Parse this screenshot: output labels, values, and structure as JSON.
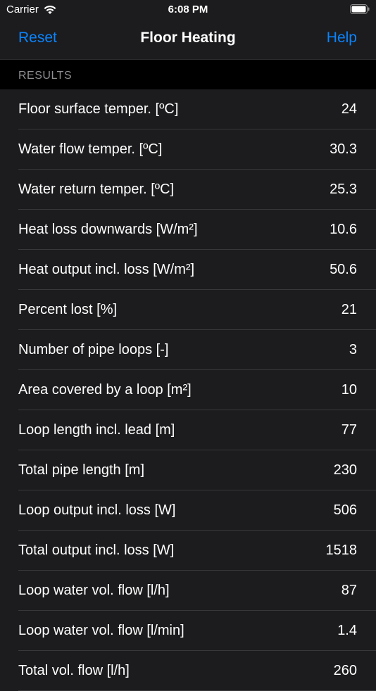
{
  "status_bar": {
    "carrier": "Carrier",
    "time": "6:08 PM",
    "icons": [
      "wifi-icon",
      "battery-icon"
    ]
  },
  "nav": {
    "left_label": "Reset",
    "title": "Floor Heating",
    "right_label": "Help"
  },
  "section": {
    "header": "RESULTS"
  },
  "results": [
    {
      "label": "Floor surface temper. [ºC]",
      "value": "24"
    },
    {
      "label": "Water flow temper. [ºC]",
      "value": "30.3"
    },
    {
      "label": "Water return temper. [ºC]",
      "value": "25.3"
    },
    {
      "label": "Heat loss downwards [W/m²]",
      "value": "10.6"
    },
    {
      "label": "Heat output incl. loss [W/m²]",
      "value": "50.6"
    },
    {
      "label": "Percent lost [%]",
      "value": "21"
    },
    {
      "label": "Number of pipe loops [-]",
      "value": "3"
    },
    {
      "label": "Area covered by a loop [m²]",
      "value": "10"
    },
    {
      "label": "Loop length incl. lead [m]",
      "value": "77"
    },
    {
      "label": "Total pipe length [m]",
      "value": "230"
    },
    {
      "label": "Loop output incl. loss [W]",
      "value": "506"
    },
    {
      "label": "Total output incl. loss [W]",
      "value": "1518"
    },
    {
      "label": "Loop water vol. flow [l/h]",
      "value": "87"
    },
    {
      "label": "Loop water vol. flow [l/min]",
      "value": "1.4"
    },
    {
      "label": "Total vol. flow [l/h]",
      "value": "260"
    }
  ],
  "colors": {
    "accent": "#0a84ff",
    "background": "#000000",
    "cell_background": "#1c1c1e",
    "separator": "#38383a",
    "secondary_text": "#8e8e93"
  }
}
